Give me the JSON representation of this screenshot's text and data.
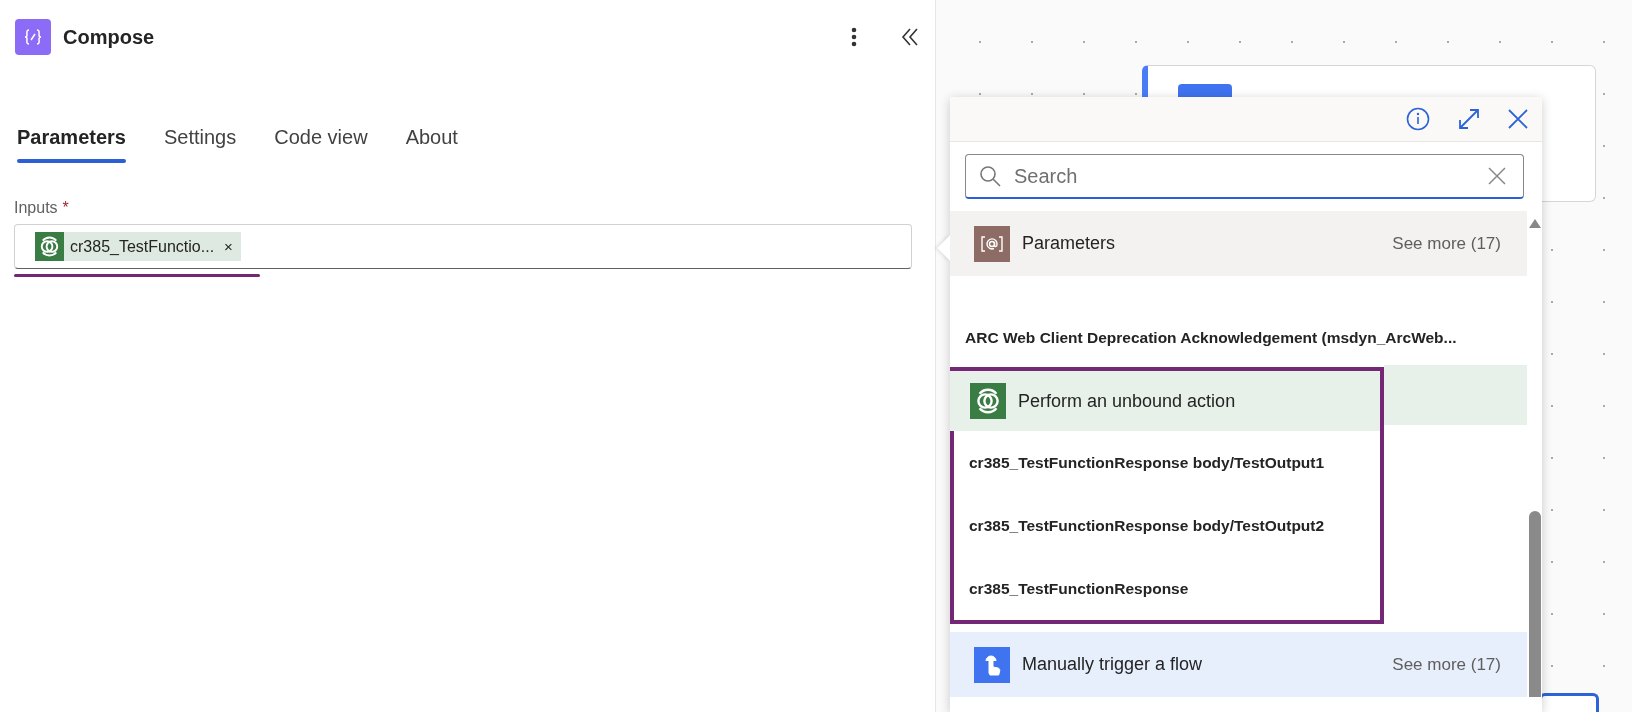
{
  "panel": {
    "title": "Compose",
    "tabs": [
      {
        "label": "Parameters",
        "selected": true
      },
      {
        "label": "Settings",
        "selected": false
      },
      {
        "label": "Code view",
        "selected": false
      },
      {
        "label": "About",
        "selected": false
      }
    ],
    "field": {
      "label": "Inputs",
      "required_mark": "*",
      "token": "cr385_TestFunctio...",
      "token_remove": "×"
    }
  },
  "picker": {
    "search": {
      "placeholder": "Search"
    },
    "groups": [
      {
        "kind": "parameters",
        "title": "Parameters",
        "see_more": "See more (17)",
        "items": [
          "ARC Web Client Deprecation Acknowledgement (msdyn_ArcWeb..."
        ]
      },
      {
        "kind": "dataverse",
        "title": "Perform an unbound action",
        "highlighted": true,
        "items": [
          "cr385_TestFunctionResponse body/TestOutput1",
          "cr385_TestFunctionResponse body/TestOutput2",
          "cr385_TestFunctionResponse"
        ]
      },
      {
        "kind": "manual",
        "title": "Manually trigger a flow",
        "see_more": "See more (17)"
      }
    ]
  }
}
